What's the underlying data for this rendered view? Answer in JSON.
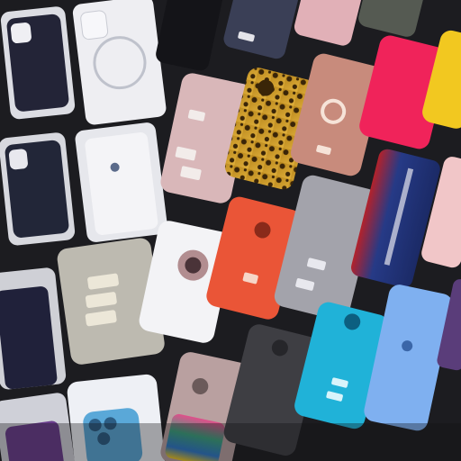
{
  "scene": {
    "description_tag": "phone-case-display-rack",
    "background": "#1c1c20",
    "case_colors": {
      "dark_navy": "#232437",
      "clear_white": "#e9eaee",
      "clear_pink": "#d9b7b9",
      "leopard": "#c89a2c",
      "rose_glitter": "#c88b7c",
      "hot_pink": "#f0235a",
      "yellow": "#f2c820",
      "red_orange": "#ea5537",
      "navy_red": "#263a86",
      "gray": "#8f8f98",
      "sky_blue": "#7fb0f0",
      "cyan": "#20b2d8",
      "dark_gray": "#3e3e43",
      "multicolor": "#3ca27f",
      "purple_dots": "#5a3d7a"
    }
  }
}
